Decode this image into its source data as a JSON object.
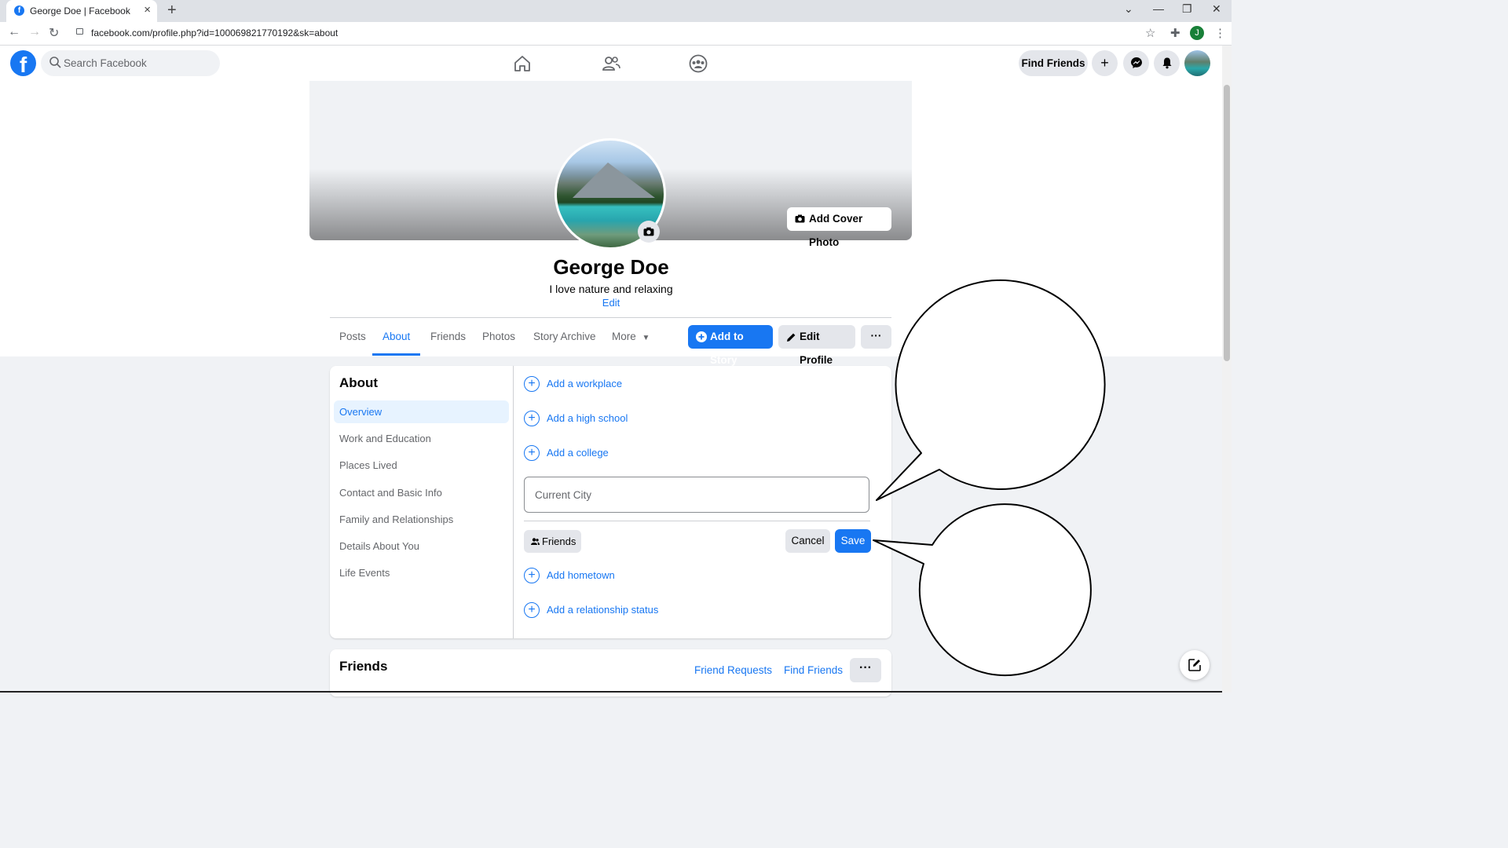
{
  "browser": {
    "tab_title": "George Doe | Facebook",
    "url": "facebook.com/profile.php?id=100069821770192&sk=about",
    "account_initial": "J"
  },
  "header": {
    "search_placeholder": "Search Facebook",
    "find_friends": "Find Friends"
  },
  "profile": {
    "name": "George Doe",
    "bio": "I love nature and relaxing",
    "bio_edit": "Edit",
    "add_cover_photo": "Add Cover Photo",
    "tabs": [
      "Posts",
      "About",
      "Friends",
      "Photos",
      "Story Archive",
      "More"
    ],
    "active_tab": "About",
    "add_to_story": "Add to Story",
    "edit_profile": "Edit Profile",
    "more_dots": "···"
  },
  "about": {
    "title": "About",
    "sidebar": [
      "Overview",
      "Work and Education",
      "Places Lived",
      "Contact and Basic Info",
      "Family and Relationships",
      "Details About You",
      "Life Events"
    ],
    "selected": "Overview",
    "add_items": [
      "Add a workplace",
      "Add a high school",
      "Add a college",
      "Add hometown",
      "Add a relationship status"
    ],
    "city_placeholder": "Current City",
    "audience": "Friends",
    "cancel": "Cancel",
    "save": "Save"
  },
  "friends_section": {
    "title": "Friends",
    "friend_requests": "Friend Requests",
    "find_friends": "Find Friends",
    "dots": "···"
  },
  "colors": {
    "brand": "#1877f2",
    "page_bg": "#f0f2f5",
    "button_gray": "#e4e6eb"
  }
}
